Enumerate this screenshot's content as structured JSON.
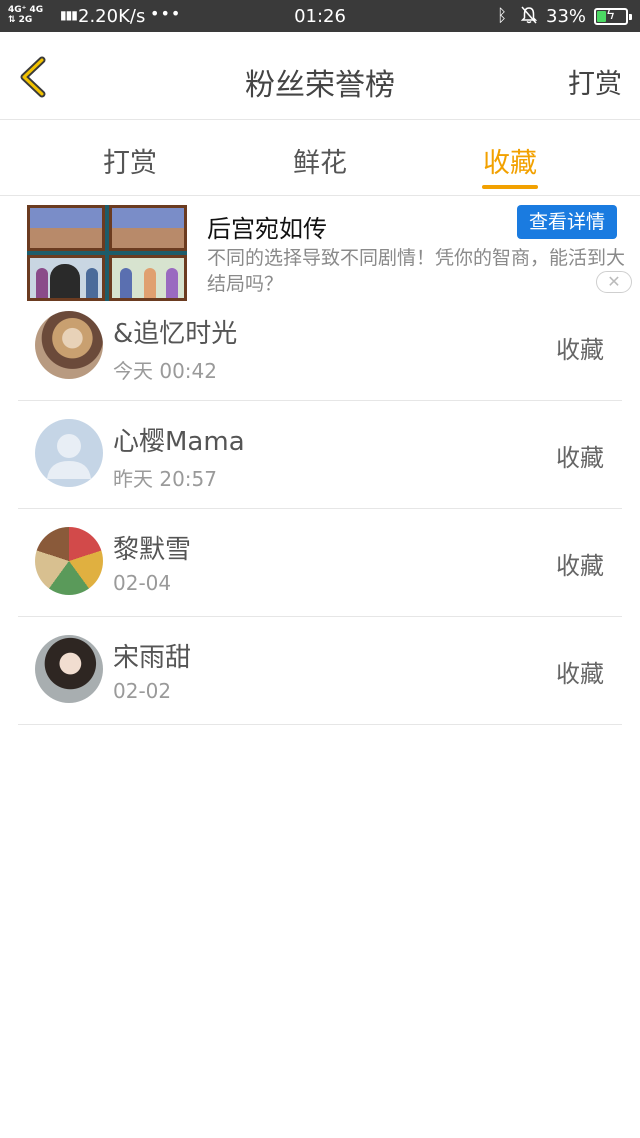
{
  "status_bar": {
    "network_top": "4G⁺ 4G",
    "network_bottom": "⇅ 2G",
    "speed": "2.20K/s",
    "more": "•••",
    "time": "01:26",
    "bluetooth_icon": "bluetooth-icon",
    "mute_icon": "bell-off-icon",
    "battery_percent": "33%",
    "battery_level": 0.33
  },
  "header": {
    "title": "粉丝荣誉榜",
    "action_label": "打赏",
    "back_icon": "chevron-left-icon"
  },
  "tabs": [
    {
      "label": "打赏"
    },
    {
      "label": "鲜花"
    },
    {
      "label": "收藏",
      "active": true
    }
  ],
  "ad": {
    "title": "后宫宛如传",
    "button_label": "查看详情",
    "description": "不同的选择导致不同剧情！凭你的智商，能活到大结局吗？",
    "close_label": "✕"
  },
  "entries": [
    {
      "name": "&追忆时光",
      "time": "今天 00:42",
      "action": "收藏"
    },
    {
      "name": "心樱Mama",
      "time": "昨天 20:57",
      "action": "收藏"
    },
    {
      "name": "黎默雪",
      "time": "02-04",
      "action": "收藏"
    },
    {
      "name": "宋雨甜",
      "time": "02-02",
      "action": "收藏"
    }
  ],
  "colors": {
    "accent": "#f2a100",
    "ad_button": "#1a7be0",
    "status_bar": "#3a3a3a"
  }
}
